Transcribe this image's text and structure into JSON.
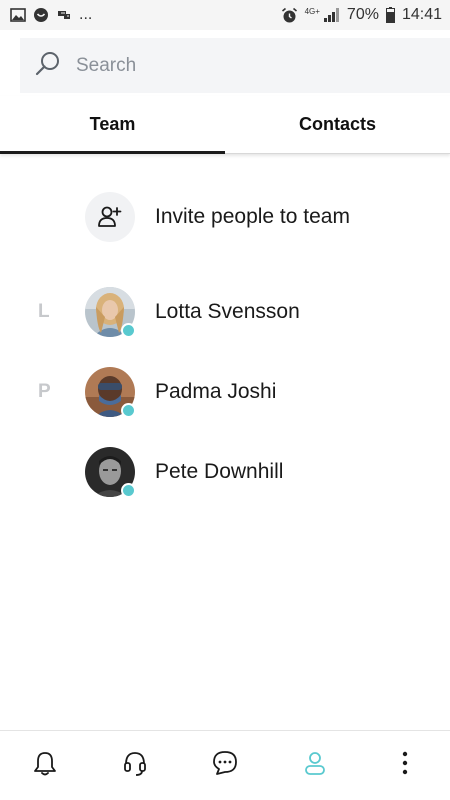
{
  "status_bar": {
    "overflow": "...",
    "network": "4G+",
    "battery": "70%",
    "time": "14:41"
  },
  "search": {
    "placeholder": "Search",
    "value": ""
  },
  "tabs": [
    {
      "label": "Team",
      "active": true
    },
    {
      "label": "Contacts",
      "active": false
    }
  ],
  "invite": {
    "label": "Invite people to team"
  },
  "members": [
    {
      "section": "L",
      "name": "Lotta Svensson",
      "online": true
    },
    {
      "section": "P",
      "name": "Padma Joshi",
      "online": true
    },
    {
      "section": "",
      "name": "Pete Downhill",
      "online": true
    }
  ],
  "bottom_nav": [
    {
      "icon": "bell-icon"
    },
    {
      "icon": "headset-icon"
    },
    {
      "icon": "chat-bubble-icon"
    },
    {
      "icon": "person-icon",
      "active": true
    },
    {
      "icon": "more-vertical-icon"
    }
  ],
  "colors": {
    "accent": "#59c9cf",
    "text": "#1a1a1a",
    "muted": "#c7c9cc",
    "search_bg": "#f4f5f7"
  }
}
